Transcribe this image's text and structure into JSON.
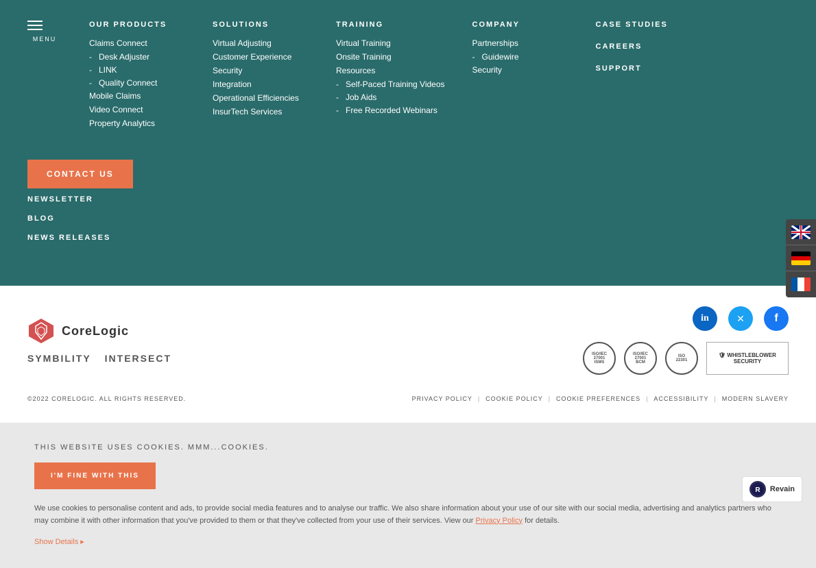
{
  "menu": {
    "label": "MENU"
  },
  "nav": {
    "products": {
      "heading": "OUR PRODUCTS",
      "items": [
        {
          "label": "Claims Connect",
          "indent": false
        },
        {
          "label": "Desk Adjuster",
          "indent": true
        },
        {
          "label": "LINK",
          "indent": true
        },
        {
          "label": "Quality Connect",
          "indent": true
        },
        {
          "label": "Mobile Claims",
          "indent": false
        },
        {
          "label": "Video Connect",
          "indent": false
        },
        {
          "label": "Property Analytics",
          "indent": false
        }
      ]
    },
    "solutions": {
      "heading": "SOLUTIONS",
      "items": [
        {
          "label": "Virtual Adjusting",
          "indent": false
        },
        {
          "label": "Customer Experience",
          "indent": false
        },
        {
          "label": "Security",
          "indent": false
        },
        {
          "label": "Integration",
          "indent": false
        },
        {
          "label": "Operational Efficiencies",
          "indent": false
        },
        {
          "label": "InsurTech Services",
          "indent": false
        }
      ]
    },
    "training": {
      "heading": "TRAINING",
      "items": [
        {
          "label": "Virtual Training",
          "indent": false
        },
        {
          "label": "Onsite Training",
          "indent": false
        },
        {
          "label": "Resources",
          "indent": false
        },
        {
          "label": "Self-Paced Training Videos",
          "indent": true
        },
        {
          "label": "Job Aids",
          "indent": true
        },
        {
          "label": "Free Recorded Webinars",
          "indent": true
        }
      ]
    },
    "company": {
      "heading": "COMPANY",
      "items": [
        {
          "label": "Partnerships",
          "indent": false
        },
        {
          "label": "Guidewire",
          "indent": true
        },
        {
          "label": "Security",
          "indent": false
        }
      ]
    },
    "case_studies": {
      "heading": "CASE STUDIES"
    },
    "careers": {
      "heading": "CAREERS"
    },
    "support": {
      "heading": "SUPPORT"
    },
    "contact": {
      "label": "CONTACT US"
    },
    "newsletter": {
      "label": "NEWSLETTER"
    },
    "blog": {
      "label": "BLOG"
    },
    "news_releases": {
      "label": "NEWS RELEASES"
    }
  },
  "footer": {
    "corelogic_logo_text": "CoreLogic",
    "symbility_label": "SYMBILITY",
    "intersect_label": "INTERSECT",
    "copyright": "©2022 CORELOGIC. ALL RIGHTS RESERVED.",
    "links": [
      {
        "label": "PRIVACY POLICY"
      },
      {
        "label": "COOKIE POLICY"
      },
      {
        "label": "COOKIE PREFERENCES"
      },
      {
        "label": "ACCESSIBILITY"
      },
      {
        "label": "MODERN SLAVERY"
      }
    ],
    "badges": [
      {
        "label": "ISO/IEC 27001 ISMS"
      },
      {
        "label": "ISO/IEC 27001 BCM"
      },
      {
        "label": "ISO 22301"
      },
      {
        "label": "WHISTLEBLOWER SECURITY"
      }
    ],
    "social": [
      {
        "label": "linkedin",
        "icon": "in"
      },
      {
        "label": "twitter",
        "icon": "𝕏"
      },
      {
        "label": "facebook",
        "icon": "f"
      }
    ]
  },
  "language": {
    "items": [
      {
        "code": "en",
        "label": "English"
      },
      {
        "code": "de",
        "label": "German"
      },
      {
        "code": "fr",
        "label": "French"
      }
    ]
  },
  "cookie": {
    "title": "THIS WEBSITE USES COOKIES. MMM...COOKIES.",
    "button_label": "I'M FINE WITH THIS",
    "body": "We use cookies to personalise content and ads, to provide social media features and to analyse our traffic. We also share information about your use of our site with our social media, advertising and analytics partners who may combine it with other information that you've provided to them or that they've collected from your use of their services. View our",
    "link_label": "Privacy Policy",
    "body_end": "for details.",
    "show_details": "Show Details ▸"
  },
  "revain": {
    "label": "Revain",
    "icon": "R"
  }
}
